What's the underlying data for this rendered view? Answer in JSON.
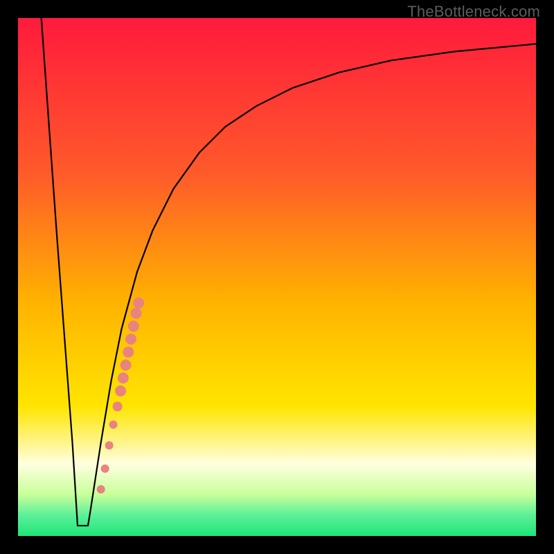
{
  "watermark": "TheBottleneck.com",
  "chart_data": {
    "type": "line",
    "title": "",
    "xlabel": "",
    "ylabel": "",
    "xlim": [
      0,
      100
    ],
    "ylim": [
      0,
      100
    ],
    "gradient_stops": [
      {
        "offset": 0,
        "color": "#ff1a3c"
      },
      {
        "offset": 30,
        "color": "#ff5a2a"
      },
      {
        "offset": 55,
        "color": "#ffb300"
      },
      {
        "offset": 75,
        "color": "#ffe500"
      },
      {
        "offset": 83,
        "color": "#fff7a0"
      },
      {
        "offset": 86,
        "color": "#ffffe0"
      },
      {
        "offset": 92,
        "color": "#c8ff9a"
      },
      {
        "offset": 96,
        "color": "#5cf098"
      },
      {
        "offset": 100,
        "color": "#1de57a"
      }
    ],
    "series": [
      {
        "name": "bottleneck-curve",
        "x": [
          4.5,
          6,
          7.5,
          9,
          10.5,
          11.5,
          12.25,
          13,
          14,
          16,
          18,
          20,
          23,
          26,
          30,
          35,
          40,
          46,
          53,
          62,
          72,
          84,
          100
        ],
        "y": [
          100,
          79,
          58,
          38,
          18,
          5,
          2,
          2,
          5,
          18,
          30,
          40,
          51,
          59,
          67,
          74,
          79,
          83,
          86.5,
          89.5,
          91.8,
          93.5,
          95
        ]
      }
    ],
    "flat_min": {
      "x_start": 11.5,
      "x_end": 13.5,
      "y": 2
    },
    "scatter": {
      "name": "highlight-points",
      "color": "#e98380",
      "points": [
        {
          "x": 16.0,
          "y": 9.0,
          "r": 6
        },
        {
          "x": 16.8,
          "y": 13.0,
          "r": 6
        },
        {
          "x": 17.6,
          "y": 17.5,
          "r": 6
        },
        {
          "x": 18.4,
          "y": 21.5,
          "r": 6
        },
        {
          "x": 19.2,
          "y": 25.0,
          "r": 7
        },
        {
          "x": 19.8,
          "y": 28.0,
          "r": 8
        },
        {
          "x": 20.3,
          "y": 30.5,
          "r": 8
        },
        {
          "x": 20.8,
          "y": 33.0,
          "r": 8
        },
        {
          "x": 21.3,
          "y": 35.5,
          "r": 8
        },
        {
          "x": 21.8,
          "y": 38.0,
          "r": 8
        },
        {
          "x": 22.3,
          "y": 40.5,
          "r": 8
        },
        {
          "x": 22.8,
          "y": 43.0,
          "r": 8
        },
        {
          "x": 23.3,
          "y": 45.0,
          "r": 8
        }
      ]
    }
  }
}
